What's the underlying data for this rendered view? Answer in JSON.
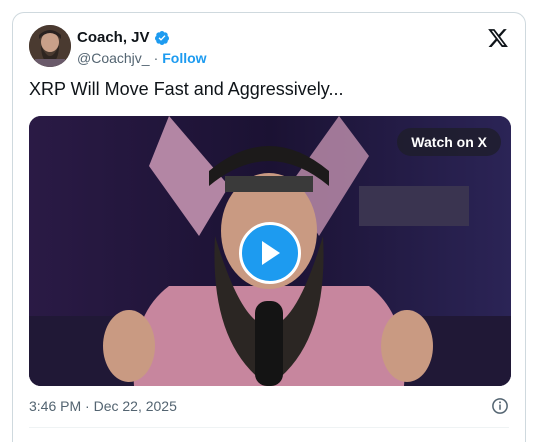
{
  "author": {
    "name": "Coach, JV",
    "handle": "@Coachjv_",
    "separator": "·",
    "follow_label": "Follow",
    "verified_color": "#1d9bf0"
  },
  "tweet": {
    "text": "XRP Will Move Fast and Aggressively..."
  },
  "media": {
    "watch_label": "Watch on X",
    "play_icon": "play-icon"
  },
  "meta": {
    "timestamp": "3:46 PM · Dec 22, 2025",
    "info_icon": "info-icon"
  },
  "colors": {
    "accent": "#1d9bf0",
    "text": "#0f1419",
    "muted": "#536471"
  }
}
